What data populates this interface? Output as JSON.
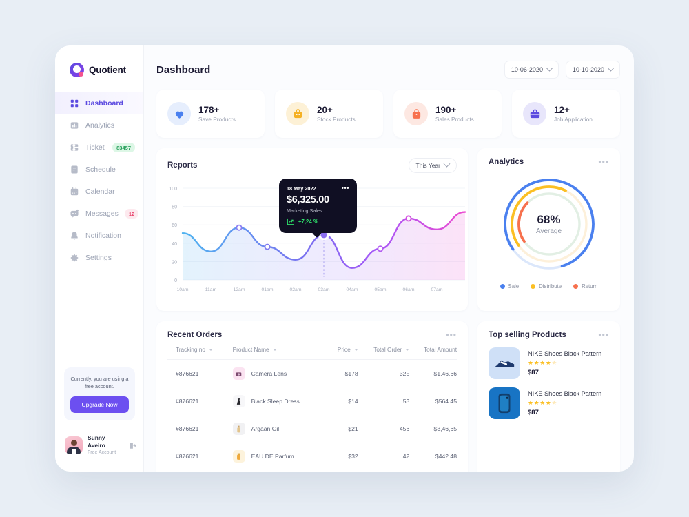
{
  "brand": {
    "name": "Quotient",
    "logo_icon": "quotient-logo"
  },
  "sidebar": {
    "items": [
      {
        "label": "Dashboard",
        "icon": "grid-icon",
        "badge": null,
        "active": true
      },
      {
        "label": "Analytics",
        "icon": "bar-chart-icon",
        "badge": null,
        "active": false
      },
      {
        "label": "Ticket",
        "icon": "ticket-icon",
        "badge": "83457",
        "badge_color": "green",
        "active": false
      },
      {
        "label": "Schedule",
        "icon": "document-icon",
        "badge": null,
        "active": false
      },
      {
        "label": "Calendar",
        "icon": "calendar-icon",
        "badge": null,
        "active": false
      },
      {
        "label": "Messages",
        "icon": "chat-icon",
        "badge": "12",
        "badge_color": "red",
        "active": false
      },
      {
        "label": "Notification",
        "icon": "bell-icon",
        "badge": null,
        "active": false
      },
      {
        "label": "Settings",
        "icon": "gear-icon",
        "badge": null,
        "active": false
      }
    ],
    "upgrade": {
      "text": "Currently, you are using a free account.",
      "button_label": "Upgrade Now",
      "button_color": "#6c4ff0"
    },
    "profile": {
      "name": "Sunny Aveiro",
      "plan": "Free Account",
      "logout_icon": "logout-icon"
    }
  },
  "header": {
    "title": "Dashboard",
    "date_from": "10-06-2020",
    "date_to": "10-10-2020",
    "chevron_icon": "chevron-down-icon"
  },
  "stats": [
    {
      "value": "178+",
      "label": "Save Products",
      "icon": "heart-icon",
      "icon_color": "#4a80ef",
      "bg": "#e6eefd"
    },
    {
      "value": "20+",
      "label": "Stock Products",
      "icon": "box-icon",
      "icon_color": "#f5b124",
      "bg": "#fdf1d6"
    },
    {
      "value": "190+",
      "label": "Sales Products",
      "icon": "shopping-bag-icon",
      "icon_color": "#f7714e",
      "bg": "#fde8e2"
    },
    {
      "value": "12+",
      "label": "Job Application",
      "icon": "briefcase-icon",
      "icon_color": "#5b4ae0",
      "bg": "#e8e6fb"
    }
  ],
  "reports": {
    "title": "Reports",
    "range_label": "This Year",
    "tooltip": {
      "date": "18 May 2022",
      "amount": "$6,325.00",
      "subtitle": "Marketing Sales",
      "delta": "+7,24 %",
      "delta_color": "#2ee06a",
      "trend_icon": "trend-up-icon",
      "menu_icon": "more-dots-icon"
    }
  },
  "chart_data": {
    "type": "area",
    "title": "Reports",
    "xlabel": "",
    "ylabel": "",
    "ylim": [
      0,
      100
    ],
    "yticks": [
      0,
      20,
      40,
      60,
      80,
      100
    ],
    "grid": true,
    "categories": [
      "10am",
      "11am",
      "12am",
      "01am",
      "02am",
      "03am",
      "04am",
      "05am",
      "06am",
      "07am"
    ],
    "series": [
      {
        "name": "Marketing Sales",
        "values": [
          51,
          31,
          57,
          36,
          22,
          49,
          13,
          34,
          67,
          55,
          74
        ],
        "markers": [
          {
            "x_label": "12am",
            "value": 57,
            "style": "hollow"
          },
          {
            "x_label": "01am",
            "value": 36,
            "style": "hollow"
          },
          {
            "x_label": "02:30am",
            "value": 49,
            "style": "filled-active"
          },
          {
            "x_label": "05am",
            "value": 34,
            "style": "hollow"
          },
          {
            "x_label": "06am",
            "value": 67,
            "style": "hollow"
          }
        ]
      }
    ]
  },
  "analytics": {
    "title": "Analytics",
    "center_value": "68%",
    "center_label": "Average",
    "menu_icon": "more-dots-icon",
    "rings": [
      {
        "name": "Sale",
        "color": "#4a80ef",
        "percent": 80
      },
      {
        "name": "Distribute",
        "color": "#fbbf24",
        "percent": 42
      },
      {
        "name": "Return",
        "color": "#f7714e",
        "percent": 22
      }
    ]
  },
  "recent_orders": {
    "title": "Recent Orders",
    "menu_icon": "more-dots-icon",
    "columns": [
      "Tracking no",
      "Product Name",
      "Price",
      "Total Order",
      "Total Amount"
    ],
    "rows": [
      {
        "tracking": "#876621",
        "product": "Camera Lens",
        "price": "$178",
        "order": "325",
        "amount": "$1,46,66",
        "thumb_icon": "camera-icon",
        "thumb_bg": "#fbe3f1"
      },
      {
        "tracking": "#876621",
        "product": "Black Sleep Dress",
        "price": "$14",
        "order": "53",
        "amount": "$564.45",
        "thumb_icon": "dress-icon",
        "thumb_bg": "#f7f7f9"
      },
      {
        "tracking": "#876621",
        "product": "Argaan Oil",
        "price": "$21",
        "order": "456",
        "amount": "$3,46,65",
        "thumb_icon": "bottle-icon",
        "thumb_bg": "#f1f1f3"
      },
      {
        "tracking": "#876621",
        "product": "EAU DE Parfum",
        "price": "$32",
        "order": "42",
        "amount": "$442.48",
        "thumb_icon": "perfume-icon",
        "thumb_bg": "#fdf3dc"
      }
    ]
  },
  "top_selling": {
    "title": "Top selling Products",
    "menu_icon": "more-dots-icon",
    "items": [
      {
        "name": "NIKE Shoes Black Pattern",
        "price": "$87",
        "rating": 4,
        "max_rating": 5,
        "thumb_icon": "sneaker-icon",
        "thumb_bg": "#cfe0f7"
      },
      {
        "name": "NIKE Shoes Black Pattern",
        "price": "$87",
        "rating": 4,
        "max_rating": 5,
        "thumb_icon": "phone-icon",
        "thumb_bg": "#1874c4"
      }
    ]
  }
}
